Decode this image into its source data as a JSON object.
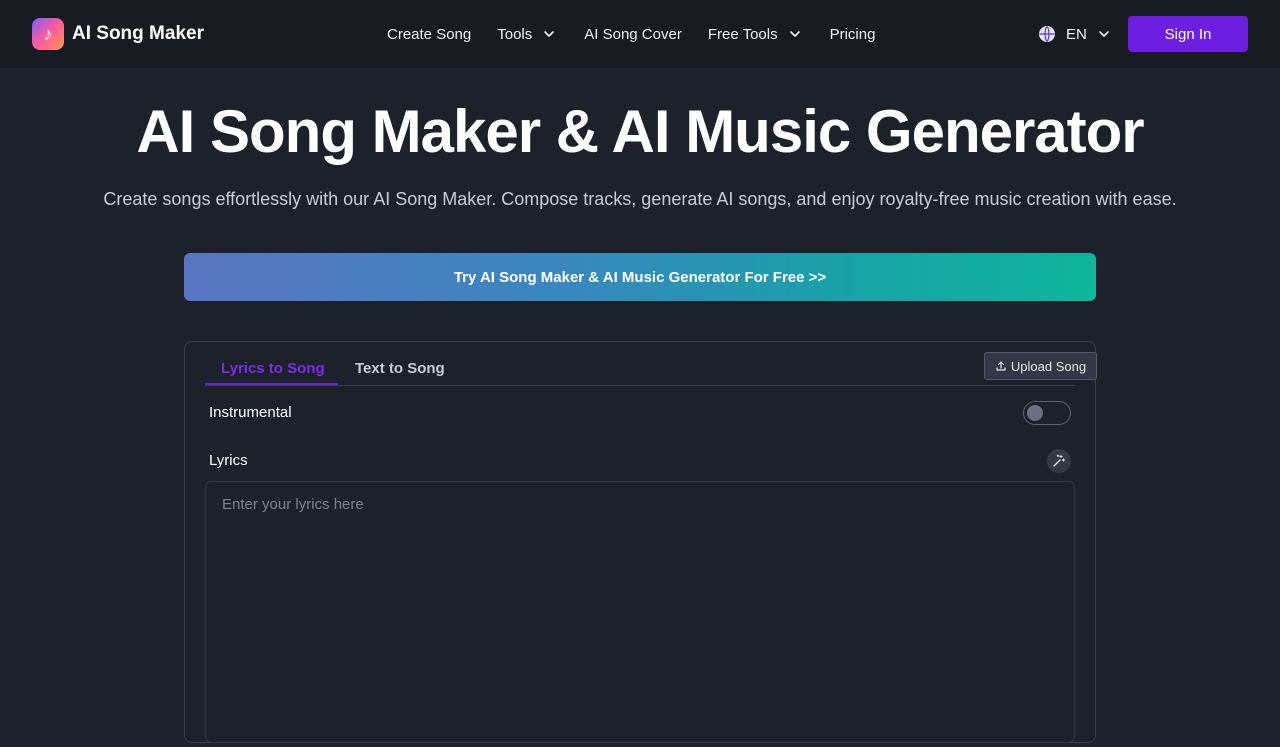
{
  "header": {
    "brand": "AI Song Maker",
    "nav": [
      {
        "label": "Create Song",
        "dropdown": false
      },
      {
        "label": "Tools",
        "dropdown": true
      },
      {
        "label": "AI Song Cover",
        "dropdown": false
      },
      {
        "label": "Free Tools",
        "dropdown": true
      },
      {
        "label": "Pricing",
        "dropdown": false
      }
    ],
    "language": "EN",
    "sign_in": "Sign In"
  },
  "hero": {
    "title": "AI Song Maker & AI Music Generator",
    "subtitle": "Create songs effortlessly with our AI Song Maker. Compose tracks, generate AI songs, and enjoy royalty-free music creation with ease.",
    "cta": "Try AI Song Maker & AI Music Generator For Free >>"
  },
  "generator": {
    "tabs": [
      {
        "label": "Lyrics to Song",
        "active": true
      },
      {
        "label": "Text to Song",
        "active": false
      }
    ],
    "upload_label": "Upload Song",
    "instrumental_label": "Instrumental",
    "instrumental_on": false,
    "lyrics_label": "Lyrics",
    "lyrics_placeholder": "Enter your lyrics here",
    "lyrics_value": ""
  },
  "colors": {
    "background": "#1d2129",
    "accent": "#6c1fe0",
    "cta_gradient_start": "#5a74c2",
    "cta_gradient_end": "#10b59a"
  },
  "icons": [
    "music-note-logo-icon",
    "chevron-down-icon",
    "globe-icon",
    "upload-icon",
    "sparkle-icon"
  ]
}
